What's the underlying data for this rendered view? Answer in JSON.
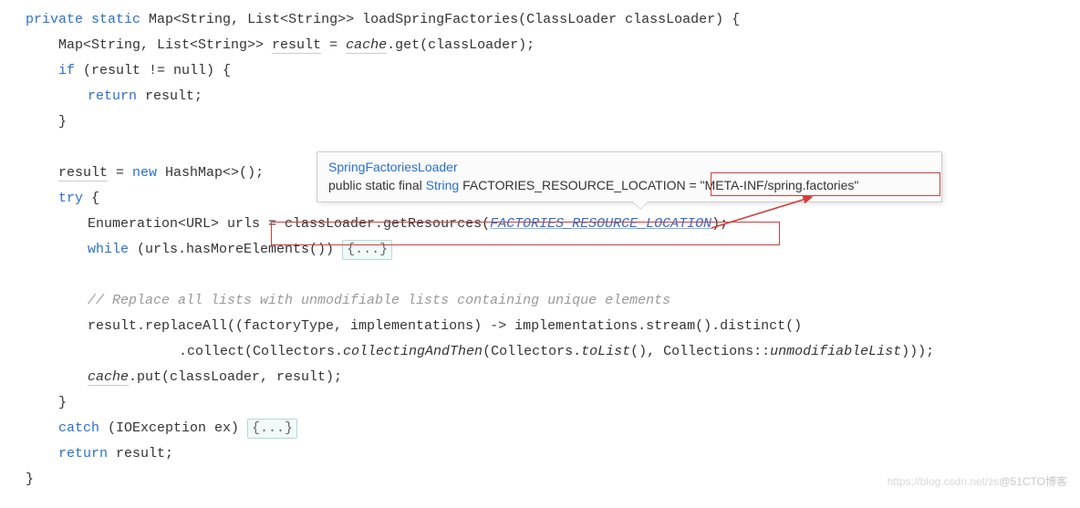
{
  "code": {
    "l1_private": "private",
    "l1_static": "static",
    "l1_rest": " Map<String, List<String>> loadSpringFactories(ClassLoader classLoader) {",
    "l2_text1": "Map<String, List<String>> ",
    "l2_result": "result",
    "l2_eq": " = ",
    "l2_cache": "cache",
    "l2_rest": ".get(classLoader);",
    "l3_if": "if",
    "l3_rest": " (result != null) {",
    "l4_return": "return",
    "l4_rest": " result;",
    "l5_text": "}",
    "l7_result": "result",
    "l7_eq": " = ",
    "l7_new": "new",
    "l7_rest": " HashMap<>();",
    "l8_try": "try",
    "l8_rest": " {",
    "l9_text1": "Enumeration<URL> urls = classLoader.getResources(",
    "l9_const": "FACTORIES_RESOURCE_LOCATION",
    "l9_text2": ");",
    "l10_while": "while",
    "l10_text1": " (urls.hasMoreElements()) ",
    "l10_fold": "{...}",
    "l12_cmt": "// Replace all lists with unmodifiable lists containing unique elements",
    "l13_text1": "result.replaceAll((factoryType, implementations) -> implementations.stream().distinct()",
    "l14_text1": ".collect(Collectors.",
    "l14_m1": "collectingAndThen",
    "l14_text2": "(Collectors.",
    "l14_m2": "toList",
    "l14_text3": "(), Collections::",
    "l14_m3": "unmodifiableList",
    "l14_text4": ")));",
    "l15_cache": "cache",
    "l15_rest": ".put(classLoader, result);",
    "l16_text": "}",
    "l17_catch": "catch",
    "l17_text1": " (IOException ex) ",
    "l17_fold": "{...}",
    "l18_return": "return",
    "l18_rest": " result;",
    "l19_text": "}"
  },
  "tooltip": {
    "classname": "SpringFactoriesLoader",
    "modifier1": "public static final ",
    "type": "String",
    "fieldname": " FACTORIES_RESOURCE_LOCATION = ",
    "value": "\"META-INF/spring.factories\""
  },
  "watermark": {
    "left": "https://blog.csdn.net/zs",
    "right": "@51CTO博客"
  }
}
